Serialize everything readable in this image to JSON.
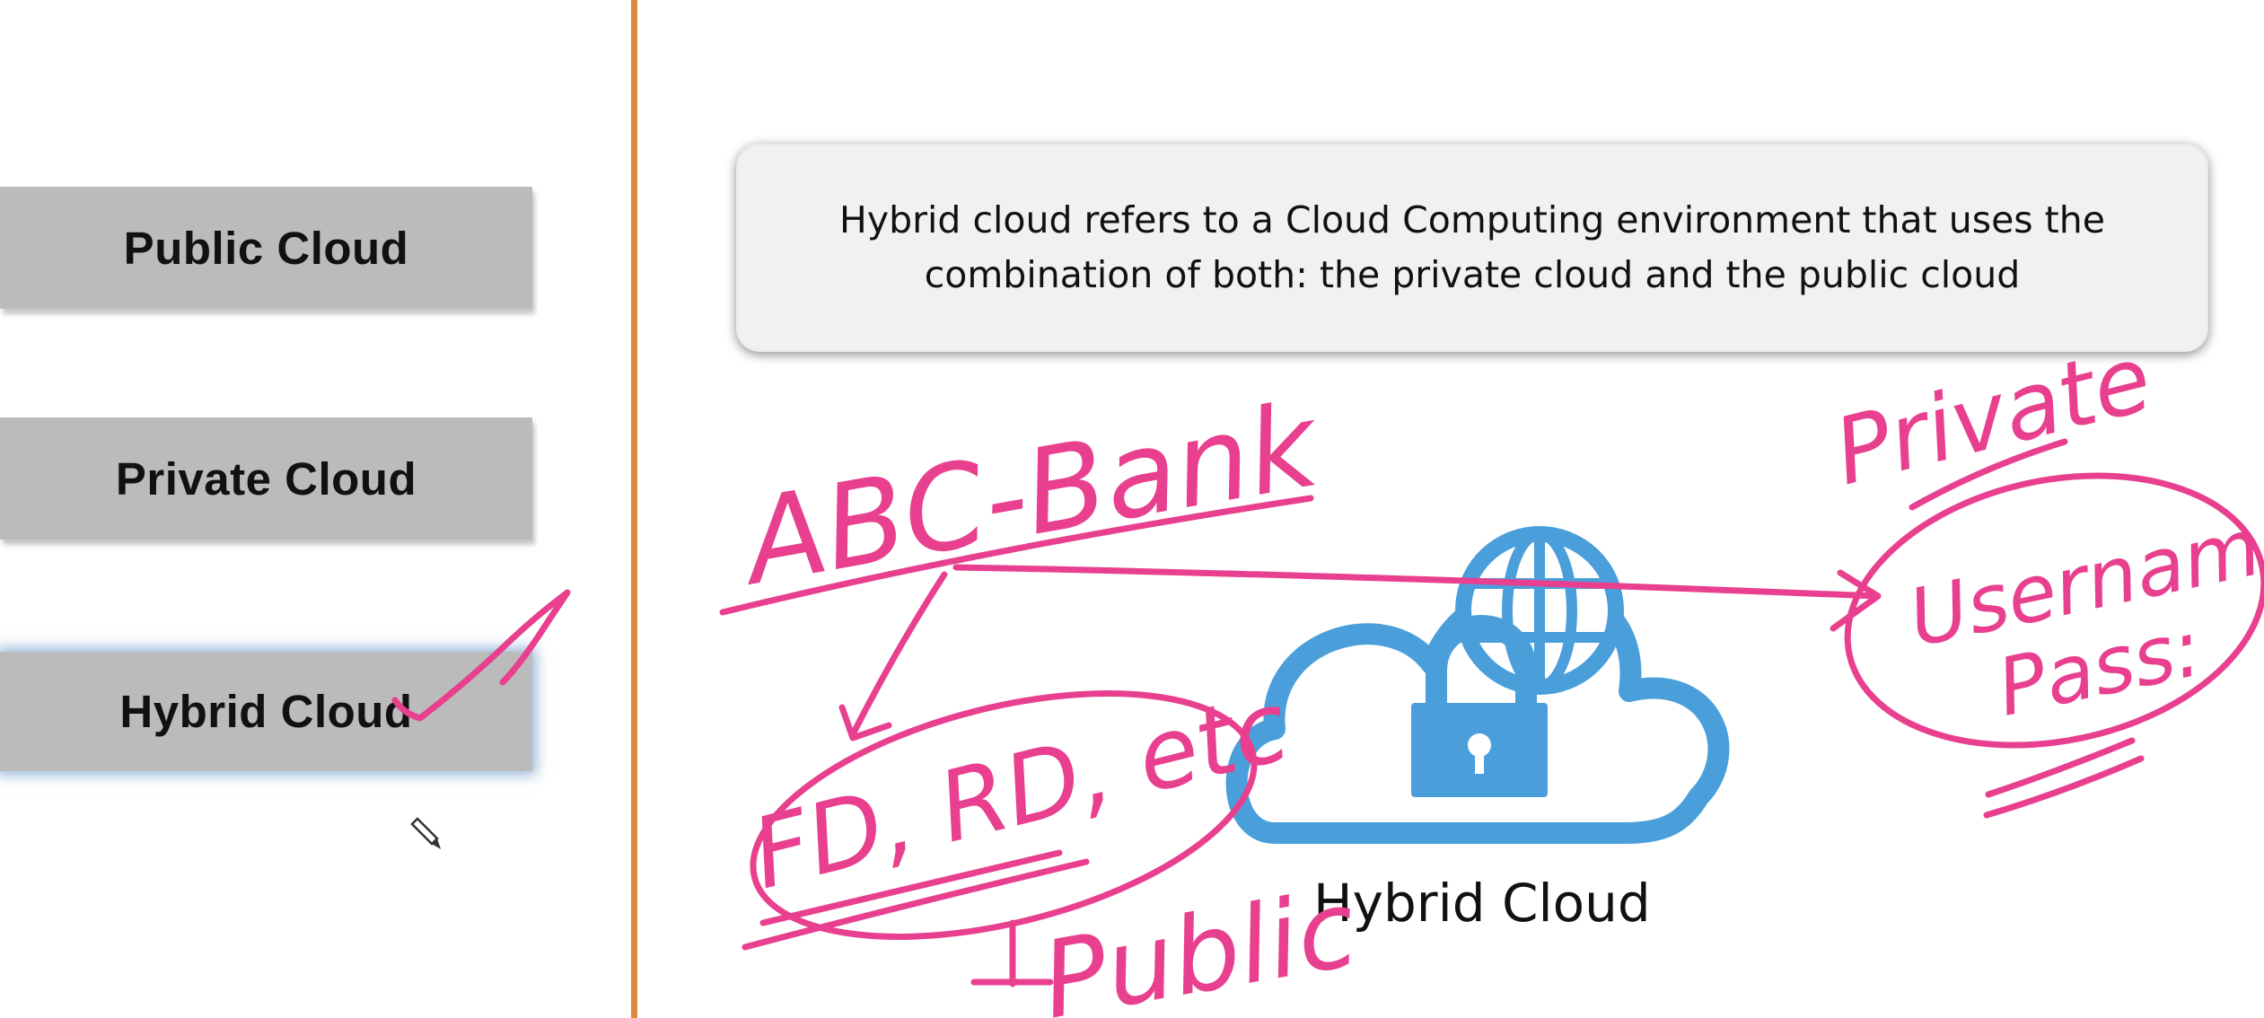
{
  "sidebar": {
    "items": [
      {
        "label": "Public Cloud"
      },
      {
        "label": "Private Cloud"
      },
      {
        "label": "Hybrid Cloud",
        "selected": true
      }
    ]
  },
  "slide": {
    "definition": "Hybrid cloud refers to a Cloud Computing environment that uses the combination of both: the private cloud and the public cloud",
    "image_caption": "Hybrid Cloud"
  },
  "annotations": {
    "ink_color": "#e8408f",
    "texts": [
      "ABC-Bank",
      "FD, RD, etc",
      "Private",
      "Username Pass:",
      "Public"
    ]
  },
  "colors": {
    "accent_divider": "#e0873a",
    "button_bg": "#bcbbbc",
    "cloud_icon": "#4a9fdb"
  },
  "icons": [
    "cloud-icon",
    "globe-icon",
    "padlock-icon",
    "pen-cursor-icon"
  ]
}
